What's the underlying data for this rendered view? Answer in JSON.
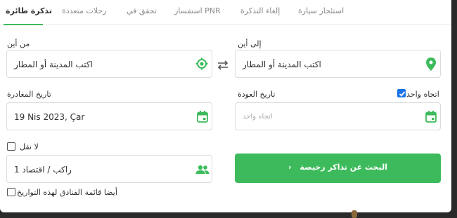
{
  "tabs": [
    {
      "label": "تذكرة طائرة",
      "active": true
    },
    {
      "label": "رحلات متعددة",
      "active": false
    },
    {
      "label": "تحقق في",
      "active": false
    },
    {
      "label": "PNR استفسار",
      "active": false
    },
    {
      "label": "إلغاء التذكرة",
      "active": false
    },
    {
      "label": "استئجار سيارة",
      "active": false
    }
  ],
  "from": {
    "label": "من أين",
    "value": "اكتب المدينة أو المطار"
  },
  "to": {
    "label": "إلى أين",
    "value": "اكتب المدينة أو المطار"
  },
  "departure": {
    "label": "تاريخ المغادرة",
    "value": "19 Nis 2023, Çar"
  },
  "return": {
    "label": "تاريخ العودة",
    "placeholder": "اتجاه واحد"
  },
  "one_way": {
    "label": "اتجاه واحد",
    "checked": true
  },
  "nonstop": {
    "label": "لا نقل",
    "checked": false
  },
  "passengers": {
    "value": "راكب / اقتصاد 1"
  },
  "search_button": {
    "label": "البحث عن تذاكر رخيصة"
  },
  "hotels": {
    "label": "أيضا قائمة الفنادق لهذه التواريخ",
    "checked": false
  },
  "colors": {
    "accent": "#3dbb5c",
    "checkbox": "#1a73e8"
  }
}
